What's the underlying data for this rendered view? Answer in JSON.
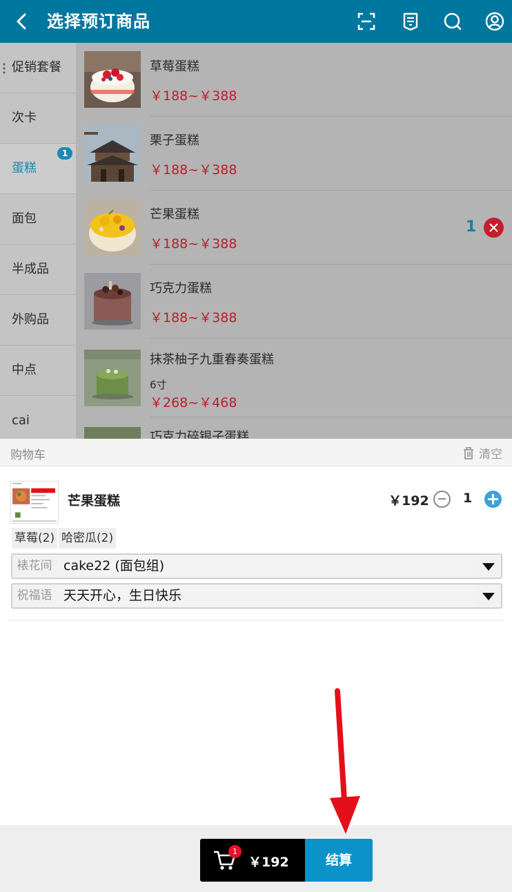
{
  "header": {
    "title": "选择预订商品",
    "icons": [
      "back-icon",
      "scan-icon",
      "receipt-icon",
      "search-icon",
      "account-icon"
    ],
    "bg_color": "#00779e"
  },
  "sidebar": {
    "items": [
      {
        "label": "促销套餐"
      },
      {
        "label": "次卡"
      },
      {
        "label": "蛋糕",
        "badge": "1"
      },
      {
        "label": "面包"
      },
      {
        "label": "半成品"
      },
      {
        "label": "外购品"
      },
      {
        "label": "中点"
      },
      {
        "label": "cai"
      }
    ]
  },
  "products": [
    {
      "name": "草莓蛋糕",
      "price": "￥188~￥388"
    },
    {
      "name": "栗子蛋糕",
      "price": "￥188~￥388"
    },
    {
      "name": "芒果蛋糕",
      "price": "￥188~￥388",
      "qty": "1"
    },
    {
      "name": "巧克力蛋糕",
      "price": "￥188~￥388"
    },
    {
      "name": "抹茶柚子九重春奏蛋糕",
      "sub": "6寸",
      "price": "￥268~￥468"
    },
    {
      "name": "巧克力碎银子蛋糕"
    }
  ],
  "cart": {
    "title": "购物车",
    "clear_label": "清空",
    "item": {
      "name": "芒果蛋糕",
      "price": "￥192",
      "qty": "1",
      "tags": [
        "草莓(2)",
        "哈密瓜(2)"
      ],
      "decorator": {
        "label": "裱花间",
        "value": "cake22 (面包组)"
      },
      "greeting": {
        "label": "祝福语",
        "value": "天天开心，生日快乐"
      }
    }
  },
  "checkout": {
    "cart_badge": "1",
    "total": "￥192",
    "button_label": "结算",
    "button_color": "#0b93c9"
  },
  "colors": {
    "price": "#c01b2c",
    "accent": "#1a8ab4",
    "annotation": "#e3101b"
  }
}
